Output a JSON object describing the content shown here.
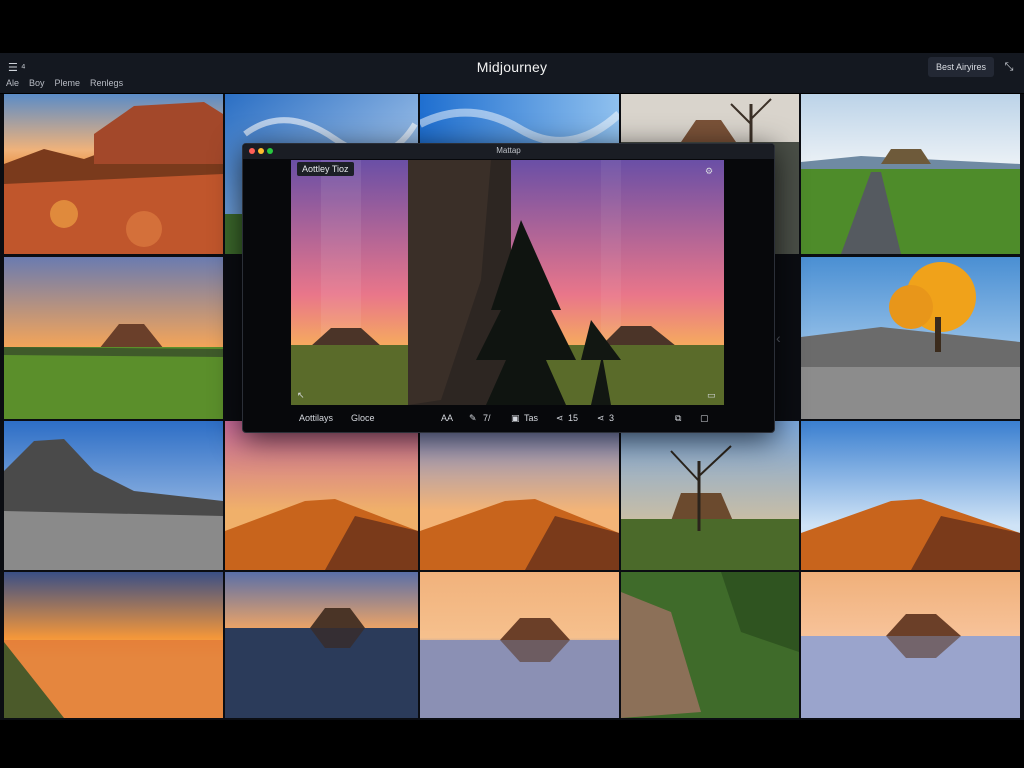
{
  "app": {
    "title": "Midjourney",
    "menu_icon": "☰ ⁴",
    "menu": [
      "Ale",
      "Boy",
      "Pleme",
      "Renlegs"
    ],
    "action_button": "Best Airyires",
    "expand_icon": "⤡"
  },
  "modal": {
    "title": "Mattap",
    "preview_label": "Aottley Tioz",
    "footer": {
      "left": "Aottilays",
      "left2": "Gloce",
      "aa": "AA",
      "edit": "7/",
      "tas": "Tas",
      "share1": "15",
      "share2": "3"
    }
  },
  "colors": {
    "background": "#000000",
    "appbar": "#141820",
    "modal_bg": "#07080b",
    "dot_red": "#ff5f57",
    "dot_yellow": "#febc2e",
    "dot_green": "#28c840"
  }
}
